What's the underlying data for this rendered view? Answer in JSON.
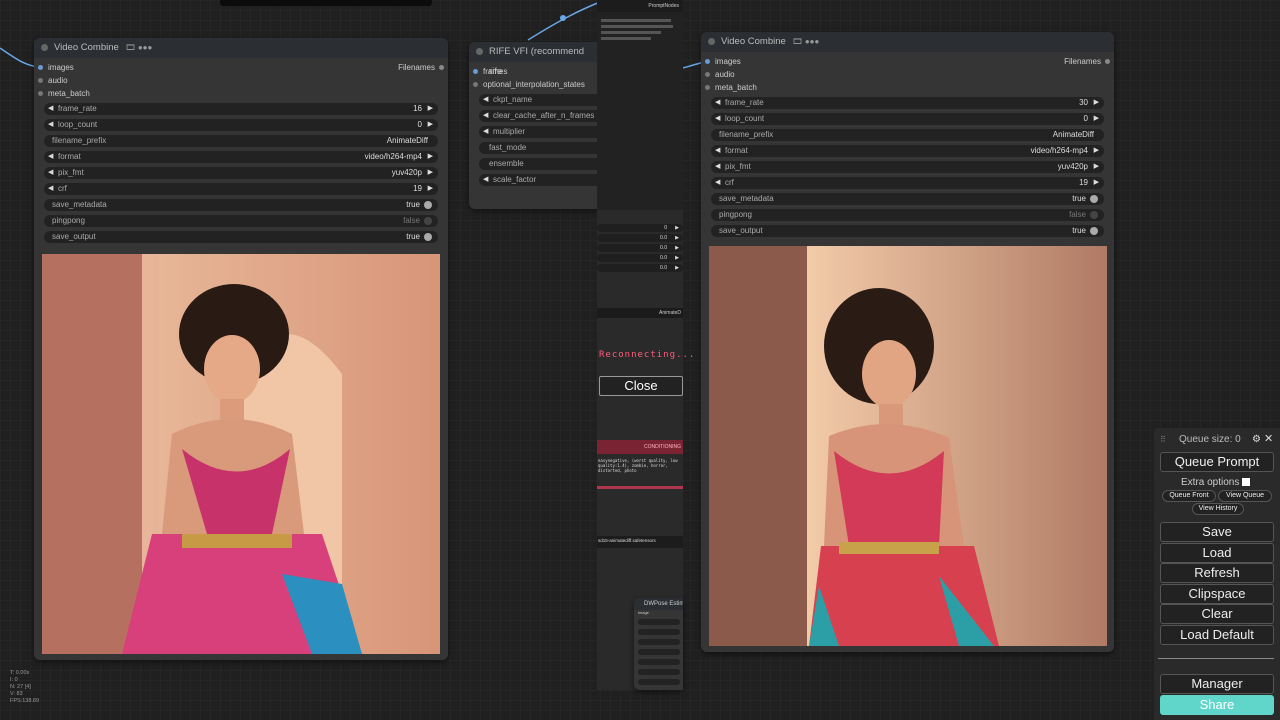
{
  "canvas": {
    "stats": [
      "T: 0.00s",
      "I: 0",
      "N: 27 [4]",
      "V: 83",
      "FPS:138.89"
    ]
  },
  "node_left": {
    "title": "Video Combine",
    "badge": "🎞 ●●●",
    "inputs": [
      "images",
      "audio",
      "meta_batch"
    ],
    "output": "Filenames",
    "widgets": [
      {
        "label": "frame_rate",
        "value": "16",
        "kind": "num"
      },
      {
        "label": "loop_count",
        "value": "0",
        "kind": "num"
      },
      {
        "label": "filename_prefix",
        "value": "AnimateDiff",
        "kind": "text"
      },
      {
        "label": "format",
        "value": "video/h264-mp4",
        "kind": "combo"
      },
      {
        "label": "pix_fmt",
        "value": "yuv420p",
        "kind": "combo"
      },
      {
        "label": "crf",
        "value": "19",
        "kind": "num"
      },
      {
        "label": "save_metadata",
        "value": "true",
        "kind": "toggle"
      },
      {
        "label": "pingpong",
        "value": "false",
        "kind": "toggle"
      },
      {
        "label": "save_output",
        "value": "true",
        "kind": "toggle"
      }
    ]
  },
  "node_middle": {
    "title": "RIFE VFI (recommend rife",
    "inputs": [
      "frames",
      "optional_interpolation_states"
    ],
    "widgets": [
      "ckpt_name",
      "clear_cache_after_n_frames",
      "multiplier",
      "fast_mode",
      "ensemble",
      "scale_factor"
    ]
  },
  "node_right": {
    "title": "Video Combine",
    "badge": "🎞 ●●●",
    "inputs": [
      "images",
      "audio",
      "meta_batch"
    ],
    "output": "Filenames",
    "widgets": [
      {
        "label": "frame_rate",
        "value": "30",
        "kind": "num"
      },
      {
        "label": "loop_count",
        "value": "0",
        "kind": "num"
      },
      {
        "label": "filename_prefix",
        "value": "AnimateDiff",
        "kind": "text"
      },
      {
        "label": "format",
        "value": "video/h264-mp4",
        "kind": "combo"
      },
      {
        "label": "pix_fmt",
        "value": "yuv420p",
        "kind": "combo"
      },
      {
        "label": "crf",
        "value": "19",
        "kind": "num"
      },
      {
        "label": "save_metadata",
        "value": "true",
        "kind": "toggle"
      },
      {
        "label": "pingpong",
        "value": "false",
        "kind": "toggle"
      },
      {
        "label": "save_output",
        "value": "true",
        "kind": "toggle"
      }
    ]
  },
  "overlay": {
    "reconnecting": "Reconnecting...",
    "close": "Close",
    "prompt_node_title": "PromptNodes",
    "animate_title": "AnimateD",
    "conditioning": "CONDITIONING",
    "model_file": "sd15-animatediff.safetensors",
    "neg_prompt": "easynegative, (worst quality, low quality:1.4), zombie, horror, distorted, photo",
    "numbers": [
      "0",
      "0.0",
      "0.0",
      "0.0",
      "0.0"
    ]
  },
  "dwpose": {
    "title": "DWPose Estimator",
    "input": "image"
  },
  "panel": {
    "queue_size": "Queue size: 0",
    "queue_prompt": "Queue Prompt",
    "extra_options": "Extra options",
    "queue_front": "Queue Front",
    "view_queue": "View Queue",
    "view_history": "View History",
    "save": "Save",
    "load": "Load",
    "refresh": "Refresh",
    "clipspace": "Clipspace",
    "clear": "Clear",
    "load_default": "Load Default",
    "manager": "Manager",
    "share": "Share",
    "share_color": "#5fd6c9"
  }
}
